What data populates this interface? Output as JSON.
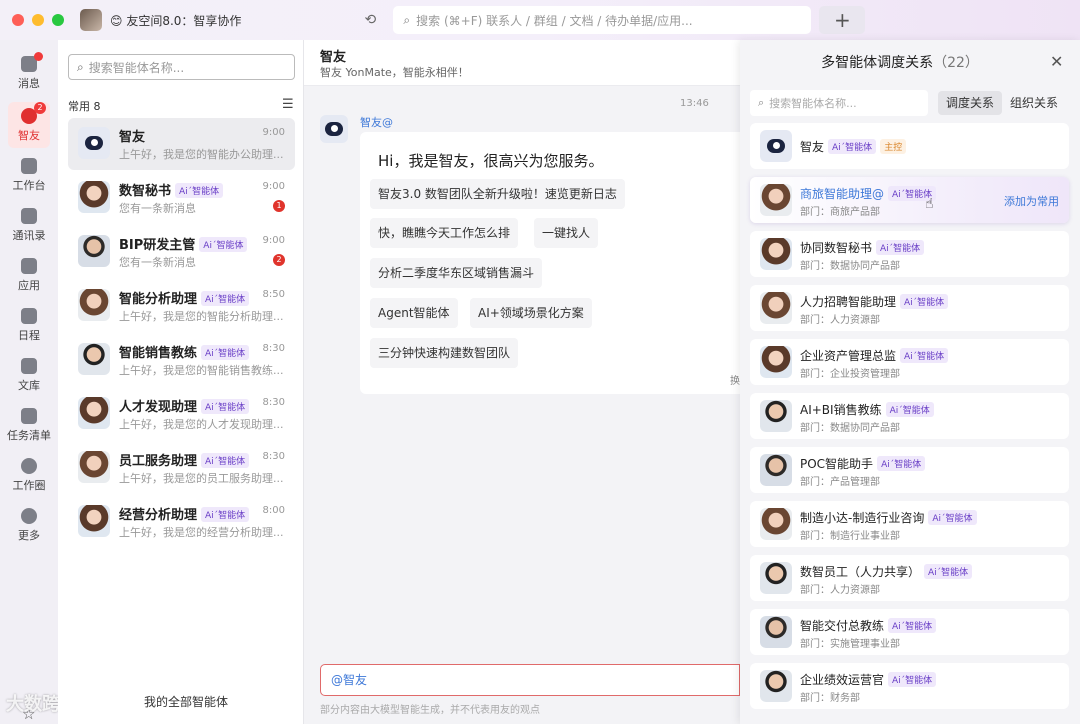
{
  "titlebar": {
    "app_title": "😊 友空间8.0：智享协作",
    "search_placeholder": "搜索 (⌘+F) 联系人 / 群组 / 文档 / 待办单据/应用...",
    "plus_label": "+"
  },
  "nav": {
    "items": [
      {
        "label": "消息",
        "icon": "message-icon",
        "badge": "dot"
      },
      {
        "label": "智友",
        "icon": "robot-icon",
        "badge": "2",
        "active": true
      },
      {
        "label": "工作台",
        "icon": "workbench-icon"
      },
      {
        "label": "通讯录",
        "icon": "contacts-icon"
      },
      {
        "label": "应用",
        "icon": "apps-icon"
      },
      {
        "label": "日程",
        "icon": "calendar-icon"
      },
      {
        "label": "文库",
        "icon": "library-icon"
      },
      {
        "label": "任务清单",
        "icon": "task-icon"
      },
      {
        "label": "工作圈",
        "icon": "compass-icon"
      },
      {
        "label": "更多",
        "icon": "more-icon"
      }
    ],
    "watermark": "大数跨境"
  },
  "convlist": {
    "search_placeholder": "搜索智能体名称...",
    "section_label": "常用 8",
    "ai_tag": "Aiˊ智能体",
    "all_agents_label": "我的全部智能体",
    "items": [
      {
        "name": "智友",
        "time": "9:00",
        "preview": "上午好，我是您的智能办公助理...",
        "avatar": "bot",
        "selected": true
      },
      {
        "name": "数智秘书",
        "time": "9:00",
        "preview": "您有一条新消息",
        "avatar": "f1",
        "badge": "1"
      },
      {
        "name": "BIP研发主管",
        "time": "9:00",
        "preview": "您有一条新消息",
        "avatar": "m1",
        "badge": "2"
      },
      {
        "name": "智能分析助理",
        "time": "8:50",
        "preview": "上午好，我是您的智能分析助理...",
        "avatar": "f2"
      },
      {
        "name": "智能销售教练",
        "time": "8:30",
        "preview": "上午好，我是您的智能销售教练...",
        "avatar": "m2"
      },
      {
        "name": "人才发现助理",
        "time": "8:30",
        "preview": "上午好，我是您的人才发现助理...",
        "avatar": "f1"
      },
      {
        "name": "员工服务助理",
        "time": "8:30",
        "preview": "上午好，我是您的员工服务助理...",
        "avatar": "f2"
      },
      {
        "name": "经营分析助理",
        "time": "8:00",
        "preview": "上午好，我是您的经营分析助理...",
        "avatar": "f1"
      }
    ]
  },
  "chat": {
    "title": "智友",
    "subtitle": "智友 YonMate，智能永相伴！",
    "time": "13:46",
    "bot_name": "智友@",
    "greeting": "Hi，我是智友，很高兴为您服务。",
    "chips": [
      "智友3.0 数智团队全新升级啦！速览更新日志",
      "快，瞧瞧今天工作怎么排",
      "一键找人",
      "分析二季度华东区域销售漏斗",
      "Agent智能体",
      "AI+领域场景化方案",
      "三分钟快速构建数智团队"
    ],
    "edge_text": "换",
    "input_value": "@智友",
    "disclaimer": "部分内容由大模型智能生成，并不代表用友的观点"
  },
  "panel": {
    "title": "多智能体调度关系",
    "count": "（22）",
    "search_placeholder": "搜索智能体名称...",
    "tabs": [
      "调度关系",
      "组织关系"
    ],
    "master_tag": "主控",
    "add_common": "添加为常用",
    "agents": [
      {
        "name": "智友",
        "dept": "",
        "avatar": "bot",
        "master": true
      },
      {
        "name": "商旅智能助理@",
        "dept": "部门：商旅产品部",
        "avatar": "f2",
        "hover": true
      },
      {
        "name": "协同数智秘书",
        "dept": "部门：数据协同产品部",
        "avatar": "f1"
      },
      {
        "name": "人力招聘智能助理",
        "dept": "部门：人力资源部",
        "avatar": "f2"
      },
      {
        "name": "企业资产管理总监",
        "dept": "部门：企业投资管理部",
        "avatar": "f1"
      },
      {
        "name": "AI+BI销售教练",
        "dept": "部门：数据协同产品部",
        "avatar": "m2"
      },
      {
        "name": "POC智能助手",
        "dept": "部门：产品管理部",
        "avatar": "m1"
      },
      {
        "name": "制造小达-制造行业咨询",
        "dept": "部门：制造行业事业部",
        "avatar": "f2"
      },
      {
        "name": "数智员工（人力共享）",
        "dept": "部门：人力资源部",
        "avatar": "m2"
      },
      {
        "name": "智能交付总教练",
        "dept": "部门：实施管理事业部",
        "avatar": "m1"
      },
      {
        "name": "企业绩效运营官",
        "dept": "部门：财务部",
        "avatar": "m2"
      }
    ]
  }
}
